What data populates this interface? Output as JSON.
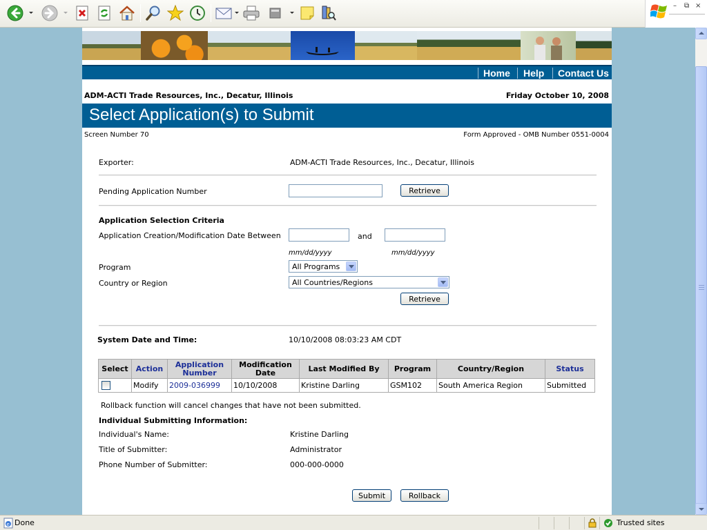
{
  "browser": {
    "toolbar_icons": [
      "back-icon",
      "forward-icon",
      "stop-icon",
      "refresh-icon",
      "home-icon",
      "search-icon",
      "favorites-icon",
      "history-icon",
      "mail-icon",
      "print-icon",
      "edit-icon",
      "discuss-icon",
      "research-icon"
    ],
    "status_text": "Done",
    "zone_text": "Trusted sites"
  },
  "nav": {
    "home": "Home",
    "help": "Help",
    "contact": "Contact Us"
  },
  "header": {
    "org": "ADM-ACTI Trade Resources, Inc., Decatur, Illinois",
    "date": "Friday October 10, 2008",
    "title": "Select Application(s) to Submit",
    "screen_number": "Screen Number 70",
    "omb": "Form Approved - OMB Number 0551-0004"
  },
  "form": {
    "exporter_label": "Exporter:",
    "exporter_value": "ADM-ACTI Trade Resources, Inc., Decatur, Illinois",
    "pending_label": "Pending Application Number",
    "pending_value": "",
    "retrieve_label": "Retrieve",
    "criteria_heading": "Application Selection Criteria",
    "date_between_label": "Application Creation/Modification Date Between",
    "date_from": "",
    "and_label": "and",
    "date_to": "",
    "date_hint": "mm/dd/yyyy",
    "program_label": "Program",
    "program_selected": "All Programs",
    "country_label": "Country or Region",
    "country_selected": "All Countries/Regions",
    "system_dt_label": "System Date and Time:",
    "system_dt_value": "10/10/2008 08:03:23 AM CDT"
  },
  "table": {
    "headers": {
      "select": "Select",
      "action": "Action",
      "application_number": "Application Number",
      "modification_date": "Modification Date",
      "last_modified_by": "Last Modified By",
      "program": "Program",
      "country_region": "Country/Region",
      "status": "Status"
    },
    "rows": [
      {
        "action": "Modify",
        "application_number": "2009-036999",
        "modification_date": "10/10/2008",
        "last_modified_by": "Kristine Darling",
        "program": "GSM102",
        "country_region": "South America Region",
        "status": "Submitted"
      }
    ]
  },
  "rollback_note": "Rollback function will cancel changes that have not been submitted.",
  "submitter": {
    "heading": "Individual Submitting Information:",
    "name_label": "Individual's Name:",
    "name_value": "Kristine Darling",
    "title_label": "Title of Submitter:",
    "title_value": "Administrator",
    "phone_label": "Phone Number of Submitter:",
    "phone_value": "000-000-0000"
  },
  "actions": {
    "submit": "Submit",
    "rollback": "Rollback"
  },
  "colors": {
    "nav_blue": "#005e94",
    "link_blue": "#1c2f98",
    "page_bg": "#97bfd2"
  }
}
